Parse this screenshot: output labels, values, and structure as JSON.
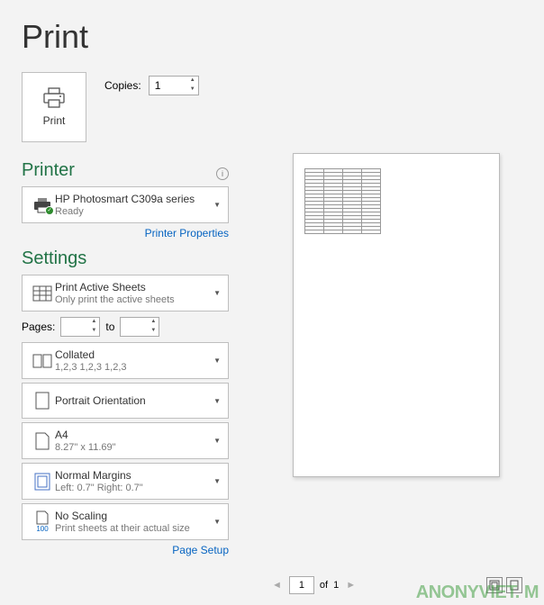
{
  "title": "Print",
  "print_button_label": "Print",
  "copies_label": "Copies:",
  "copies_value": "1",
  "printer_heading": "Printer",
  "printer_name": "HP Photosmart C309a series",
  "printer_status": "Ready",
  "printer_properties_link": "Printer Properties",
  "settings_heading": "Settings",
  "print_area": {
    "title": "Print Active Sheets",
    "sub": "Only print the active sheets"
  },
  "pages_label": "Pages:",
  "pages_from": "",
  "pages_to_label": "to",
  "pages_to": "",
  "collation": {
    "title": "Collated",
    "sub": "1,2,3    1,2,3    1,2,3"
  },
  "orientation": {
    "title": "Portrait Orientation"
  },
  "paper": {
    "title": "A4",
    "sub": "8.27\" x 11.69\""
  },
  "margins": {
    "title": "Normal Margins",
    "sub": "Left:  0.7\"    Right:  0.7\""
  },
  "scaling": {
    "title": "No Scaling",
    "sub": "Print sheets at their actual size",
    "badge": "100"
  },
  "page_setup_link": "Page Setup",
  "nav": {
    "current_page": "1",
    "of_label": "of",
    "total_pages": "1"
  },
  "watermark": "ANONYVIET.  M"
}
